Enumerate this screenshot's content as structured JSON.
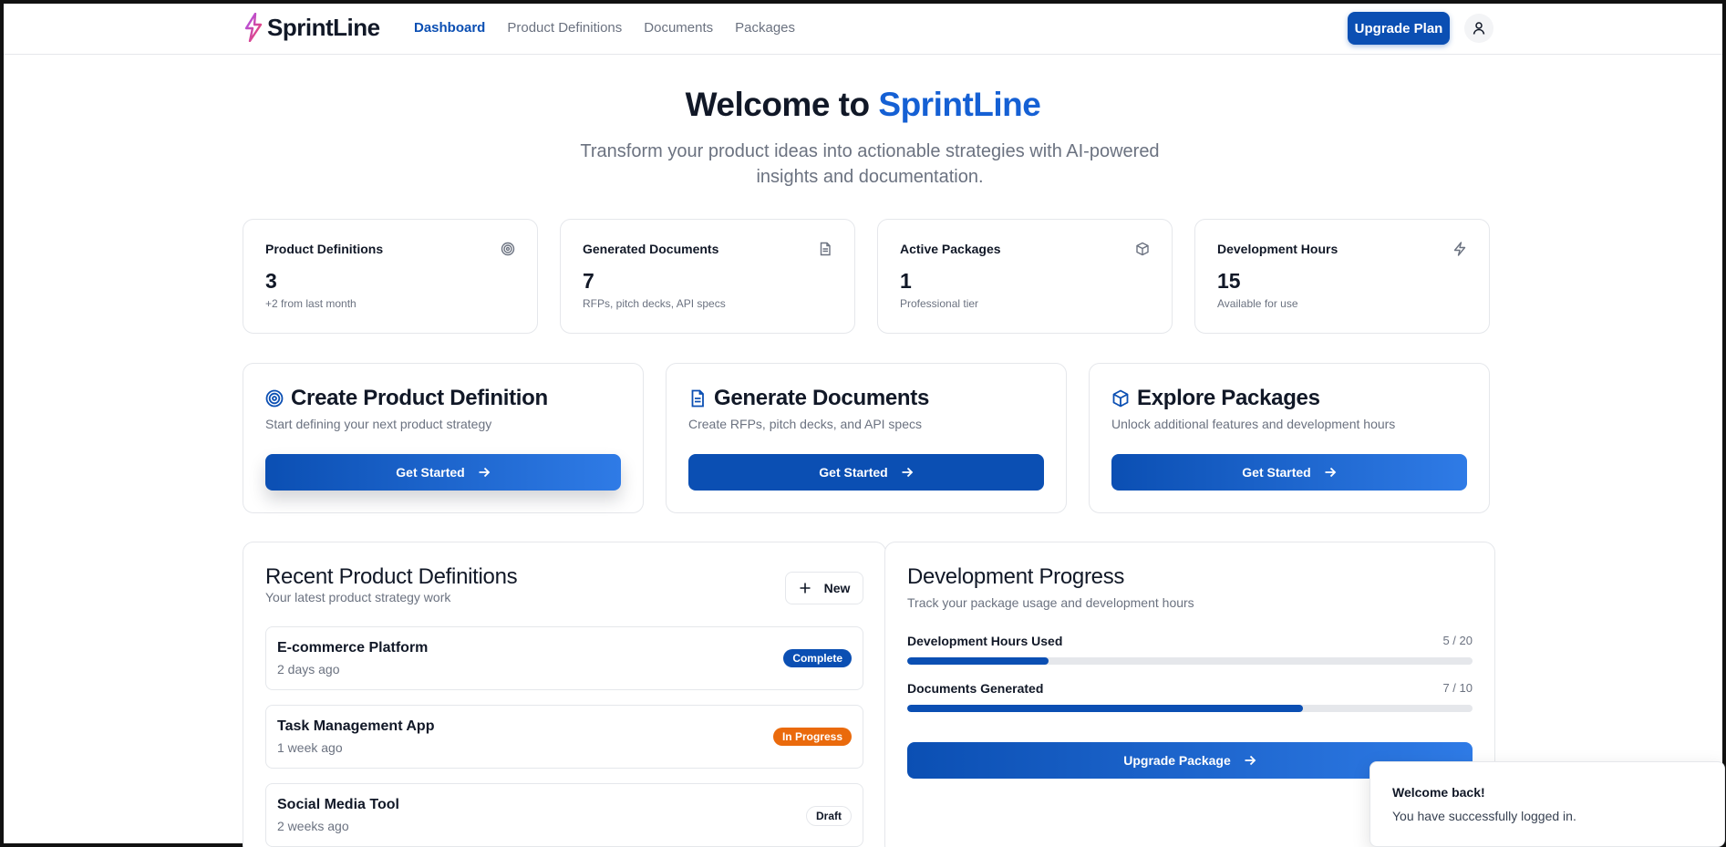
{
  "app": {
    "brand": "SprintLine",
    "accent": "#0b4fb3"
  },
  "nav": {
    "items": [
      "Dashboard",
      "Product Definitions",
      "Documents",
      "Packages"
    ],
    "active": "Dashboard"
  },
  "header": {
    "upgrade_label": "Upgrade Plan",
    "user_icon": "user-icon"
  },
  "hero": {
    "title_prefix": "Welcome to",
    "title_brand": "SprintLine",
    "subtitle": "Transform your product ideas into actionable strategies with AI-powered insights and documentation."
  },
  "stats": [
    {
      "label": "Product Definitions",
      "value": "3",
      "sub": "+2 from last month",
      "icon": "target-icon"
    },
    {
      "label": "Generated Documents",
      "value": "7",
      "sub": "RFPs, pitch decks, API specs",
      "icon": "document-icon"
    },
    {
      "label": "Active Packages",
      "value": "1",
      "sub": "Professional tier",
      "icon": "package-icon"
    },
    {
      "label": "Development Hours",
      "value": "15",
      "sub": "Available for use",
      "icon": "bolt-icon"
    }
  ],
  "actions": [
    {
      "title": "Create Product Definition",
      "desc": "Start defining your next product strategy",
      "button": "Get Started",
      "icon": "target-icon"
    },
    {
      "title": "Generate Documents",
      "desc": "Create RFPs, pitch decks, and API specs",
      "button": "Get Started",
      "icon": "document-icon"
    },
    {
      "title": "Explore Packages",
      "desc": "Unlock additional features and development hours",
      "button": "Get Started",
      "icon": "package-icon"
    }
  ],
  "recent": {
    "title": "Recent Product Definitions",
    "subtitle": "Your latest product strategy work",
    "new_label": "New",
    "items": [
      {
        "name": "E-commerce Platform",
        "time": "2 days ago",
        "status": "Complete"
      },
      {
        "name": "Task Management App",
        "time": "1 week ago",
        "status": "In Progress"
      },
      {
        "name": "Social Media Tool",
        "time": "2 weeks ago",
        "status": "Draft"
      }
    ]
  },
  "progress": {
    "title": "Development Progress",
    "subtitle": "Track your package usage and development hours",
    "rows": [
      {
        "label": "Development Hours Used",
        "value_text": "5 / 20",
        "fraction": 0.25
      },
      {
        "label": "Documents Generated",
        "value_text": "7 / 10",
        "fraction": 0.7
      }
    ],
    "button": "Upgrade Package"
  },
  "toast": {
    "title": "Welcome back!",
    "message": "You have successfully logged in."
  }
}
